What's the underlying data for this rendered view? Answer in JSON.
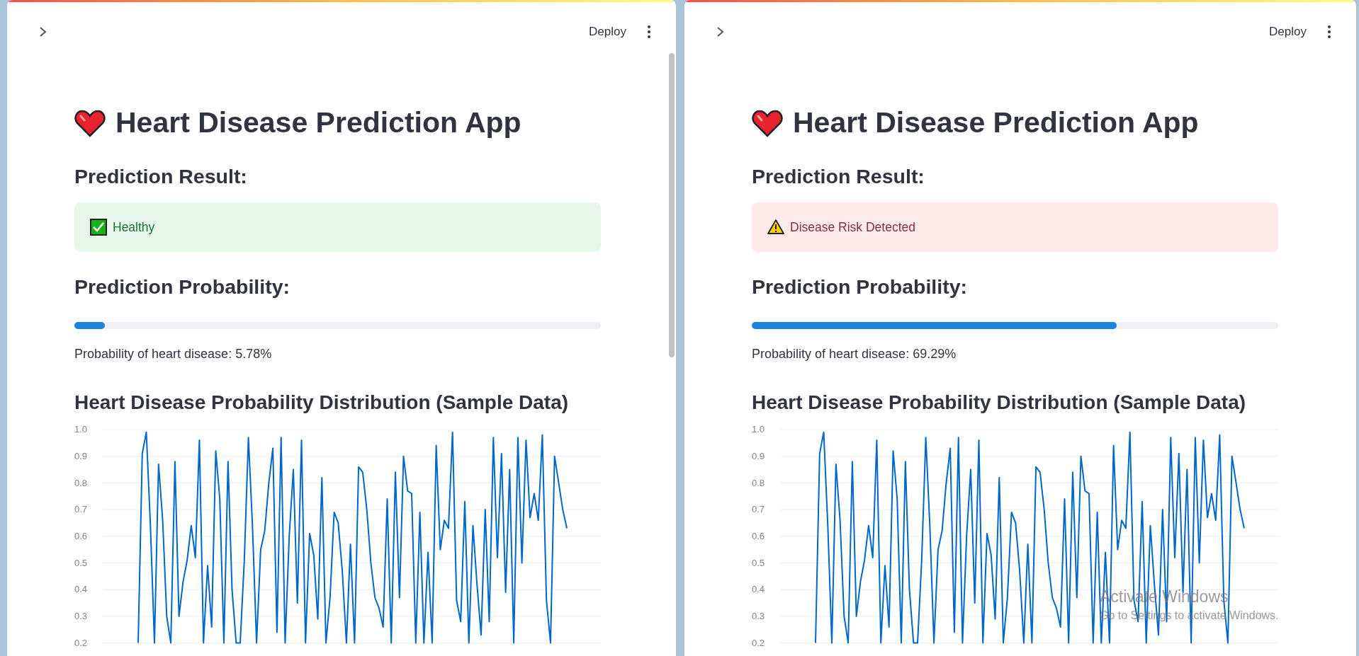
{
  "windows": [
    {
      "deploy": "Deploy",
      "title": "Heart Disease Prediction App",
      "result_heading": "Prediction Result:",
      "result": {
        "kind": "success",
        "text": "Healthy"
      },
      "probability_heading": "Prediction Probability:",
      "progress": {
        "level": 0.0578
      },
      "probability_text": "Probability of heart disease: 5.78%",
      "chart_data": {
        "type": "line",
        "title": "Heart Disease Probability Distribution (Sample Data)",
        "grid": true,
        "ylim": [
          0.2,
          1.0
        ],
        "yticks": [
          {
            "value": 1.0,
            "label": "1.0"
          },
          {
            "value": 0.9,
            "label": "0.9"
          },
          {
            "value": 0.8,
            "label": "0.8"
          },
          {
            "value": 0.7,
            "label": "0.7"
          },
          {
            "value": 0.6,
            "label": "0.6"
          },
          {
            "value": 0.5,
            "label": "0.5"
          },
          {
            "value": 0.4,
            "label": "0.4"
          },
          {
            "value": 0.3,
            "label": "0.3"
          },
          {
            "value": 0.2,
            "label": "0.2"
          }
        ],
        "categories": [
          null,
          null,
          null,
          null,
          null,
          null,
          null,
          null,
          null,
          null,
          null,
          null,
          null,
          null,
          null,
          null,
          null,
          null,
          null,
          null,
          null,
          null,
          null,
          null,
          null,
          null,
          null,
          null,
          null,
          null,
          null,
          null,
          null,
          null,
          null,
          null,
          null,
          null,
          null,
          null,
          null,
          null,
          null,
          null,
          null,
          null,
          null,
          null,
          null,
          null,
          null,
          null,
          null,
          null,
          null,
          null,
          null,
          null,
          null,
          null,
          null,
          null,
          null,
          null,
          null,
          null,
          null,
          null,
          null,
          null,
          null,
          null,
          null,
          null,
          null,
          null,
          null,
          null,
          null,
          null,
          null,
          null,
          null,
          null,
          null,
          null,
          null,
          null,
          null,
          null,
          null,
          null,
          null,
          null,
          null,
          null,
          null,
          null,
          null,
          null,
          null,
          null,
          null,
          null,
          null,
          null
        ],
        "series": [
          {
            "color": "#0068c9",
            "values": [
              0.2,
              0.91,
              0.99,
              0.64,
              0.2,
              0.87,
              0.66,
              0.3,
              0.2,
              0.88,
              0.3,
              0.43,
              0.51,
              0.64,
              0.52,
              0.96,
              0.2,
              0.49,
              0.26,
              0.92,
              0.74,
              0.2,
              0.88,
              0.4,
              0.2,
              0.2,
              0.51,
              0.97,
              0.64,
              0.2,
              0.55,
              0.62,
              0.8,
              0.93,
              0.24,
              0.97,
              0.2,
              0.6,
              0.85,
              0.35,
              0.96,
              0.2,
              0.61,
              0.53,
              0.29,
              0.82,
              0.2,
              0.37,
              0.69,
              0.65,
              0.47,
              0.2,
              0.57,
              0.2,
              0.86,
              0.84,
              0.7,
              0.5,
              0.37,
              0.33,
              0.26,
              0.74,
              0.2,
              0.84,
              0.37,
              0.9,
              0.77,
              0.76,
              0.2,
              0.69,
              0.2,
              0.54,
              0.2,
              0.94,
              0.55,
              0.66,
              0.63,
              0.99,
              0.36,
              0.28,
              0.73,
              0.2,
              0.64,
              0.42,
              0.23,
              0.7,
              0.28,
              0.97,
              0.52,
              0.91,
              0.39,
              0.85,
              0.2,
              0.97,
              0.5,
              0.96,
              0.67,
              0.76,
              0.66,
              0.98,
              0.36,
              0.2,
              0.9,
              0.8,
              0.7,
              0.63
            ]
          }
        ]
      },
      "scrollbar": true
    },
    {
      "deploy": "Deploy",
      "title": "Heart Disease Prediction App",
      "result_heading": "Prediction Result:",
      "result": {
        "kind": "error",
        "text": "Disease Risk Detected"
      },
      "probability_heading": "Prediction Probability:",
      "progress": {
        "level": 0.6929
      },
      "probability_text": "Probability of heart disease: 69.29%",
      "chart_data": {
        "type": "line",
        "title": "Heart Disease Probability Distribution (Sample Data)",
        "grid": true,
        "ylim": [
          0.2,
          1.0
        ],
        "yticks": [
          {
            "value": 1.0,
            "label": "1.0"
          },
          {
            "value": 0.9,
            "label": "0.9"
          },
          {
            "value": 0.8,
            "label": "0.8"
          },
          {
            "value": 0.7,
            "label": "0.7"
          },
          {
            "value": 0.6,
            "label": "0.6"
          },
          {
            "value": 0.5,
            "label": "0.5"
          },
          {
            "value": 0.4,
            "label": "0.4"
          },
          {
            "value": 0.3,
            "label": "0.3"
          },
          {
            "value": 0.2,
            "label": "0.2"
          }
        ],
        "categories": [
          null,
          null,
          null,
          null,
          null,
          null,
          null,
          null,
          null,
          null,
          null,
          null,
          null,
          null,
          null,
          null,
          null,
          null,
          null,
          null,
          null,
          null,
          null,
          null,
          null,
          null,
          null,
          null,
          null,
          null,
          null,
          null,
          null,
          null,
          null,
          null,
          null,
          null,
          null,
          null,
          null,
          null,
          null,
          null,
          null,
          null,
          null,
          null,
          null,
          null,
          null,
          null,
          null,
          null,
          null,
          null,
          null,
          null,
          null,
          null,
          null,
          null,
          null,
          null,
          null,
          null,
          null,
          null,
          null,
          null,
          null,
          null,
          null,
          null,
          null,
          null,
          null,
          null,
          null,
          null,
          null,
          null,
          null,
          null,
          null,
          null,
          null,
          null,
          null,
          null,
          null,
          null,
          null,
          null,
          null,
          null,
          null,
          null,
          null,
          null,
          null,
          null,
          null,
          null,
          null,
          null
        ],
        "series": [
          {
            "color": "#0068c9",
            "values": [
              0.2,
              0.91,
              0.99,
              0.64,
              0.2,
              0.87,
              0.66,
              0.3,
              0.2,
              0.88,
              0.3,
              0.43,
              0.51,
              0.64,
              0.52,
              0.96,
              0.2,
              0.49,
              0.26,
              0.92,
              0.74,
              0.2,
              0.88,
              0.4,
              0.2,
              0.2,
              0.51,
              0.97,
              0.64,
              0.2,
              0.55,
              0.62,
              0.8,
              0.93,
              0.24,
              0.97,
              0.2,
              0.6,
              0.85,
              0.35,
              0.96,
              0.2,
              0.61,
              0.53,
              0.29,
              0.82,
              0.2,
              0.37,
              0.69,
              0.65,
              0.47,
              0.2,
              0.57,
              0.2,
              0.86,
              0.84,
              0.7,
              0.5,
              0.37,
              0.33,
              0.26,
              0.74,
              0.2,
              0.84,
              0.37,
              0.9,
              0.77,
              0.76,
              0.2,
              0.69,
              0.2,
              0.54,
              0.2,
              0.94,
              0.55,
              0.66,
              0.63,
              0.99,
              0.36,
              0.28,
              0.73,
              0.2,
              0.64,
              0.42,
              0.23,
              0.7,
              0.28,
              0.97,
              0.52,
              0.91,
              0.39,
              0.85,
              0.2,
              0.97,
              0.5,
              0.96,
              0.67,
              0.76,
              0.66,
              0.98,
              0.36,
              0.2,
              0.9,
              0.8,
              0.7,
              0.63
            ]
          }
        ]
      },
      "scrollbar": false
    }
  ],
  "os_overlay": {
    "title": "Activate Windows",
    "subtitle": "Go to Settings to activate Windows."
  }
}
